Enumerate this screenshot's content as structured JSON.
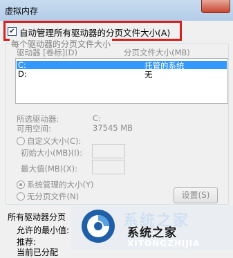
{
  "window": {
    "title": "虚拟内存"
  },
  "auto_manage": {
    "label": "自动管理所有驱动器的分页文件大小(A)",
    "checked": true
  },
  "per_drive_group": {
    "title": "每个驱动器的分页文件大小",
    "columns": [
      "驱动器 [卷标](D)",
      "分页文件大小(MB)"
    ],
    "rows": [
      {
        "drive": "C:",
        "size": "托管的系统",
        "selected": true
      },
      {
        "drive": "D:",
        "size": "无",
        "selected": false
      }
    ],
    "selected_drive_label": "所选驱动器:",
    "selected_drive_value": "C:",
    "free_space_label": "可用空间:",
    "free_space_value": "37545 MB",
    "custom_size_label": "自定义大小(C):",
    "initial_size_label": "初始大小(MB)(I):",
    "max_size_label": "最大值(MB)(X):",
    "system_managed_label": "系统管理的大小(Y)",
    "no_paging_label": "无分页文件(N)",
    "set_button": "设置(S)"
  },
  "totals": {
    "title": "所有驱动器分页",
    "min_allowed_label": "允许的最小值:",
    "recommended_label": "推荐:",
    "current_label": "当前已分配"
  },
  "watermark": {
    "text_top": "系统之家",
    "text_main": "系统之家",
    "text_sub": "XITONGZHIJIA"
  },
  "colors": {
    "highlight": "#d6201d",
    "selection": "#3399ff"
  }
}
